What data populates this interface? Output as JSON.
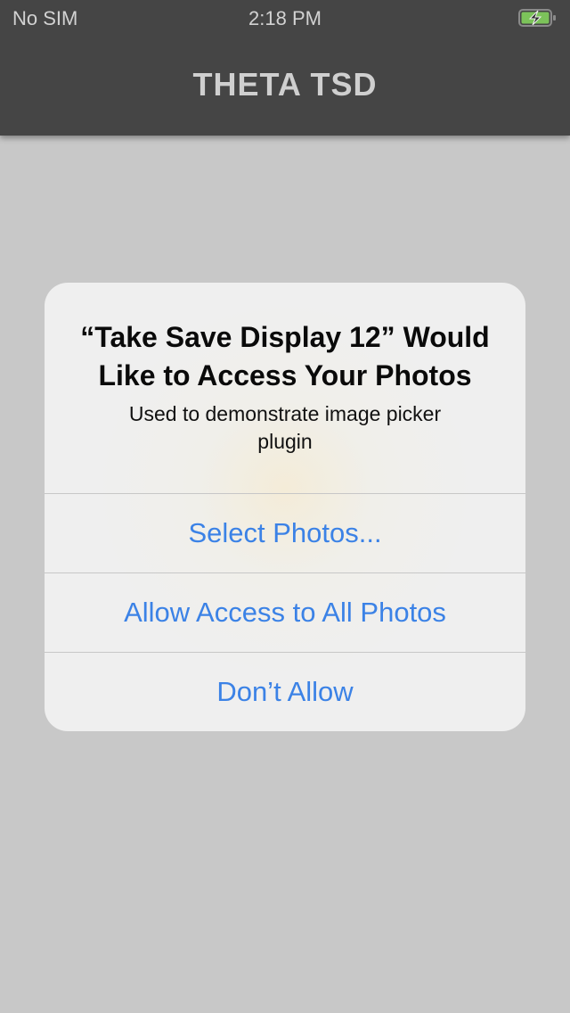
{
  "status_bar": {
    "carrier": "No SIM",
    "time": "2:18 PM",
    "battery_icon": "battery-charging-icon",
    "battery_color": "#7cc35a"
  },
  "header": {
    "title": "THETA TSD"
  },
  "alert": {
    "title": "“Take Save Display 12” Would Like to Access Your Photos",
    "message": "Used to demonstrate image picker plugin",
    "buttons": [
      {
        "label": "Select Photos..."
      },
      {
        "label": "Allow Access to All Photos"
      },
      {
        "label": "Don’t Allow"
      }
    ]
  },
  "colors": {
    "header_bg": "#454545",
    "screen_bg": "#c8c8c8",
    "alert_bg": "#efefef",
    "action_blue": "#3b82e6"
  }
}
